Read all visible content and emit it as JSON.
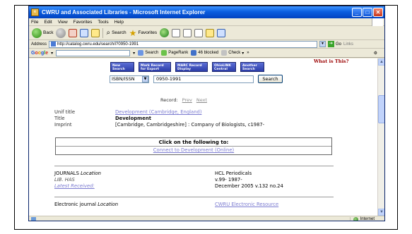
{
  "window": {
    "title": "CWRU and Associated Libraries - Microsoft Internet Explorer",
    "controls": {
      "minimize": "_",
      "maximize": "□",
      "close": "✕"
    }
  },
  "menu": [
    "File",
    "Edit",
    "View",
    "Favorites",
    "Tools",
    "Help"
  ],
  "toolbar": {
    "back_label": "Back",
    "search_label": "Search",
    "favorites_label": "Favorites"
  },
  "address": {
    "label": "Address",
    "url": "http://catalog.cwru.edu/search/i?0950-1991",
    "go_label": "Go",
    "links_label": "Links"
  },
  "google_bar": {
    "logo": [
      "G",
      "o",
      "o",
      "g",
      "l",
      "e"
    ],
    "search_label": "Search",
    "pagerank_label": "PageRank",
    "blocked_label": "46 blocked",
    "check_label": "Check"
  },
  "page": {
    "what_is_this": "What is This?",
    "nav_buttons": [
      {
        "label": "New Search"
      },
      {
        "label": "Mark Record for Export"
      },
      {
        "label": "MARC Record Display"
      },
      {
        "label": "OhioLINK Central"
      },
      {
        "label": "Another Search"
      }
    ],
    "search": {
      "type_selected": "ISBN/ISSN",
      "query": "0950-1991",
      "button": "Search"
    },
    "record_nav": {
      "label": "Record:",
      "prev": "Prev",
      "next": "Next"
    },
    "fields": [
      {
        "label": "Unif title",
        "value": "Development (Cambridge, England)"
      },
      {
        "label": "Title",
        "value": "Development"
      },
      {
        "label": "Imprint",
        "value": "[Cambridge, Cambridgeshire] : Company of Biologists, c1987-"
      }
    ],
    "click_box": {
      "heading": "Click on the following to:",
      "link": "Connect to Development (Online)"
    },
    "holdings": {
      "journals_label": "JOURNALS",
      "location_label": "Location",
      "location_value": "HCL Periodicals",
      "lib_has_label": "LIB. HAS",
      "lib_has_value": "v.99- 1987-",
      "latest_label": "Latest Received:",
      "latest_value": "December 2005 v.132 no.24",
      "electronic_label": "Electronic journal",
      "electronic_location_label": "Location",
      "electronic_value": "CWRU Electronic Resource"
    }
  },
  "status": {
    "zone": "Internet"
  }
}
